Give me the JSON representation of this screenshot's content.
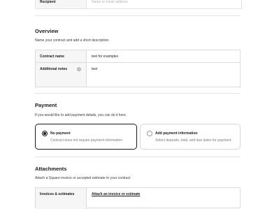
{
  "top_row": {
    "label": "Recipient",
    "value": "Name or email address"
  },
  "overview": {
    "title": "Overview",
    "description": "Name your contract and add a short description.",
    "contract_name_label": "Contract name",
    "contract_name_value": "test for examples",
    "notes_label": "Additional notes",
    "notes_info_glyph": "i",
    "notes_value": "test"
  },
  "payment": {
    "title": "Payment",
    "description": "If you would like to add payment details, you can do it here.",
    "options": [
      {
        "title": "No payment",
        "subtitle": "Contract does not require payment information",
        "selected": true
      },
      {
        "title": "Add payment information",
        "subtitle": "Select deposits, total, and due dates for payment.",
        "selected": false
      }
    ]
  },
  "attachments": {
    "title": "Attachments",
    "description": "Attach a Square invoice or accepted estimate to your contract",
    "row_label": "Invoices & estimates",
    "row_link": "Attach an invoice or estimate"
  },
  "colors": {
    "text": "#1a1a1a",
    "border": "#dcdcdc",
    "label_bg": "#f6f6f6",
    "muted": "#7a7a7a"
  }
}
